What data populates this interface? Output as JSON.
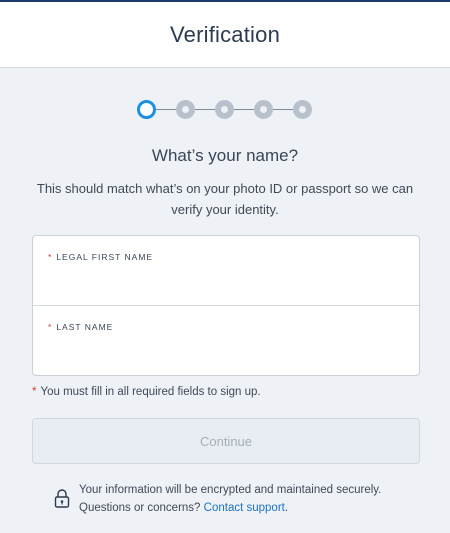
{
  "header": {
    "title": "Verification"
  },
  "stepper": {
    "total_steps": 5,
    "current_step": 1,
    "active_color": "#1a8fe3",
    "inactive_color": "#b8c1cb"
  },
  "question": "What’s your name?",
  "description": "This should match what’s on your photo ID or passport so we can verify your identity.",
  "form": {
    "required_marker": "*",
    "first_name": {
      "label": "LEGAL FIRST NAME",
      "value": ""
    },
    "last_name": {
      "label": "LAST NAME",
      "value": ""
    }
  },
  "required_note": "You must fill in all required fields to sign up.",
  "continue_button": {
    "label": "Continue",
    "disabled": true
  },
  "security": {
    "icon": "lock-icon",
    "line1": "Your information will be encrypted and maintained securely.",
    "line2_prefix": "Questions or concerns?",
    "link_text": "Contact support",
    "line2_suffix": "."
  }
}
